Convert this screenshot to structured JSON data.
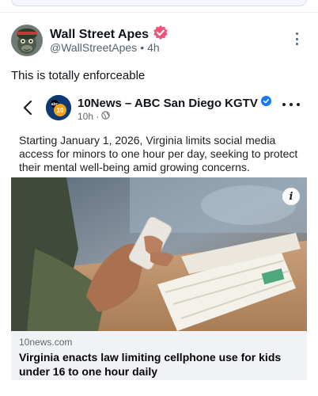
{
  "post": {
    "author_name": "Wall Street Apes",
    "handle": "@WallStreetApes",
    "separator": "•",
    "time": "4h",
    "text": "This is totally enforceable"
  },
  "embed": {
    "source_name": "10News – ABC San Diego KGTV",
    "time": "10h ·",
    "body": "Starting January 1, 2026, Virginia limits social media access for minors to one hour per day, seeking to protect their mental well-being amid growing concerns.",
    "logo_text": "abc",
    "logo_number": "10",
    "link": {
      "domain": "10news.com",
      "headline": "Virginia enacts law limiting cellphone use for kids under 16 to one hour daily"
    }
  },
  "icons": {
    "verified_badge": "verified-badge-icon",
    "more": "more-vertical-icon",
    "back": "chevron-left-icon",
    "globe": "globe-icon",
    "info": "info-icon"
  },
  "colors": {
    "verified_pink": "#f2537a",
    "fb_blue": "#1877f2",
    "link_card_bg": "#f0f2f5"
  }
}
